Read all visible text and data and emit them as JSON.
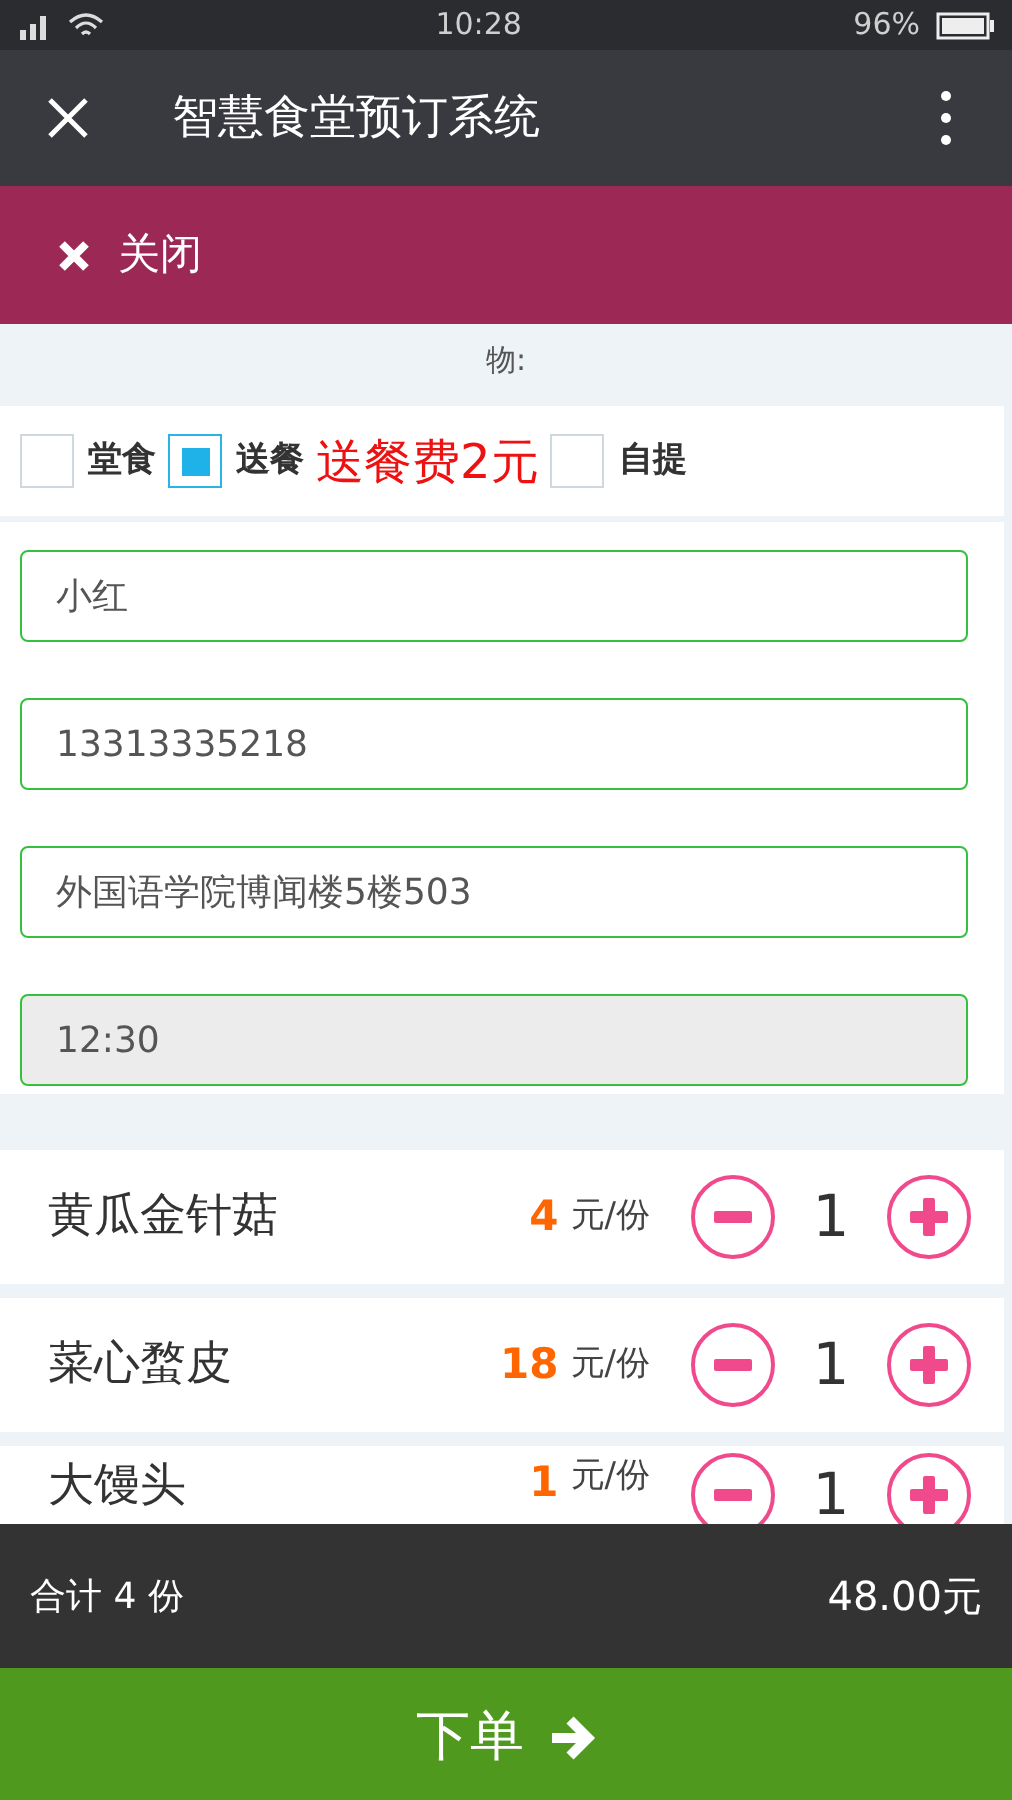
{
  "status_bar": {
    "time": "10:28",
    "battery": "96%"
  },
  "title_bar": {
    "title": "智慧食堂预订系统"
  },
  "close_banner": {
    "label": "关闭"
  },
  "partial_label": "物:",
  "options": [
    {
      "label": "堂食",
      "checked": false
    },
    {
      "label": "送餐",
      "checked": true,
      "note": "送餐费2元"
    },
    {
      "label": "自提",
      "checked": false
    }
  ],
  "fields": [
    {
      "value": "小红",
      "disabled": false
    },
    {
      "value": "13313335218",
      "disabled": false
    },
    {
      "value": "外国语学院博闻楼5楼503",
      "disabled": false
    },
    {
      "value": "12:30",
      "disabled": true
    }
  ],
  "dishes": [
    {
      "name": "黄瓜金针菇",
      "price": "4",
      "unit": "元/份",
      "quantity": "1"
    },
    {
      "name": "菜心蝥皮",
      "price": "18",
      "unit": "元/份",
      "quantity": "1"
    },
    {
      "name": "大馒头",
      "price": "1",
      "unit": "元/份",
      "quantity": "1"
    }
  ],
  "summary": {
    "count": "合计 4 份",
    "total": "48.00元"
  },
  "order_button": {
    "label": "下单"
  }
}
